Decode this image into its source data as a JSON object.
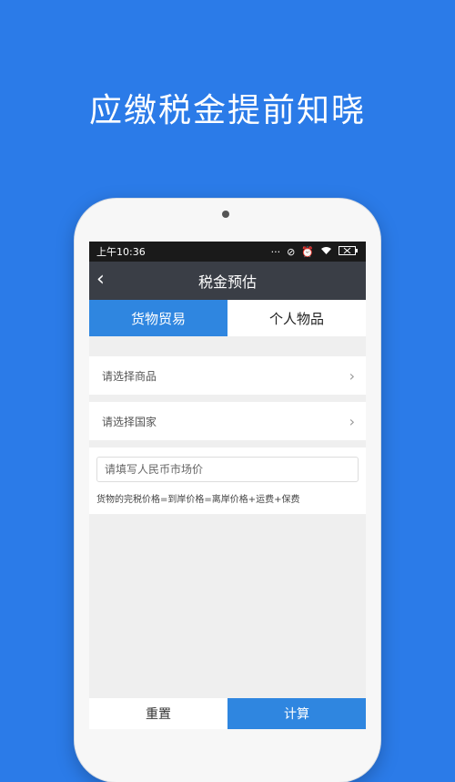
{
  "headline": "应缴税金提前知晓",
  "status_bar": {
    "time": "上午10:36",
    "icons": [
      "more-icon",
      "no-sim-icon",
      "alarm-icon",
      "wifi-icon",
      "battery-icon"
    ]
  },
  "nav": {
    "back": "‹",
    "title": "税金预估"
  },
  "tabs": [
    {
      "label": "货物贸易",
      "active": true
    },
    {
      "label": "个人物品",
      "active": false
    }
  ],
  "form": {
    "select_goods": "请选择商品",
    "select_country": "请选择国家",
    "price_placeholder": "请填写人民币市场价",
    "formula": "货物的完税价格=到岸价格=离岸价格+运费+保费"
  },
  "buttons": {
    "reset": "重置",
    "calculate": "计算"
  },
  "colors": {
    "background": "#2b7be8",
    "accent": "#2f86e0",
    "navbar": "#3a3e46"
  }
}
